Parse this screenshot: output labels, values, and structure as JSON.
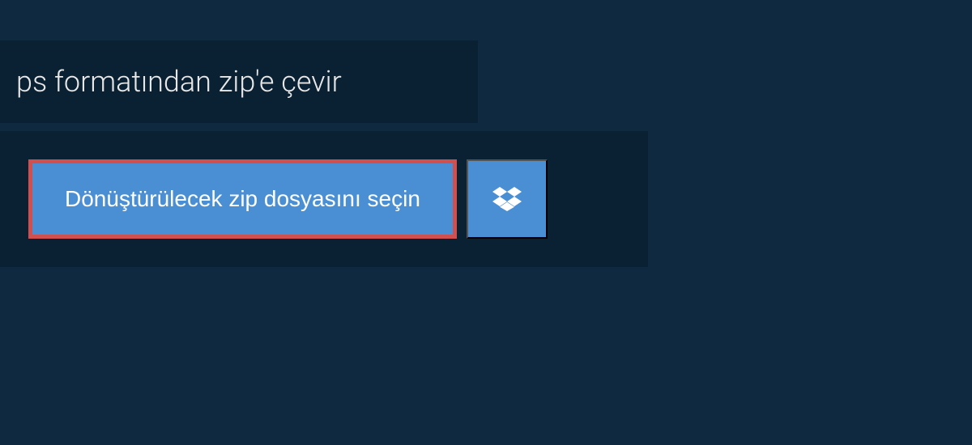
{
  "header": {
    "title": "ps formatından zip'e çevir"
  },
  "actions": {
    "select_file_label": "Dönüştürülecek zip dosyasını seçin",
    "dropbox_icon": "dropbox"
  },
  "colors": {
    "background": "#0f2940",
    "panel": "#0a2033",
    "button": "#4a8fd4",
    "highlight_border": "#d05050",
    "text": "#ffffff"
  }
}
